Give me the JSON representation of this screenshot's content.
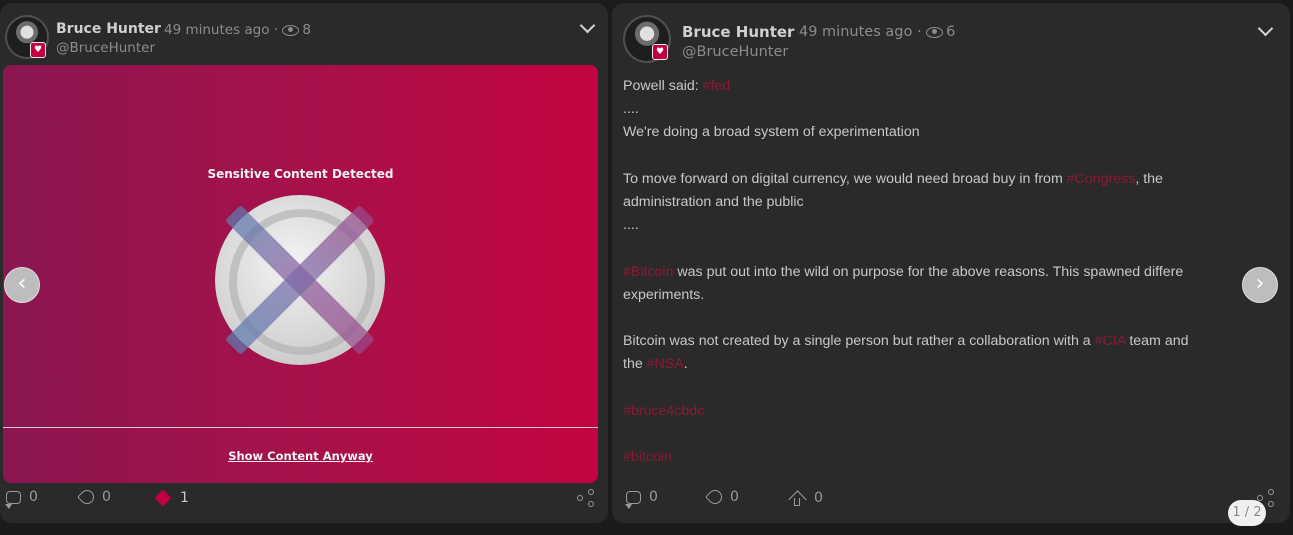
{
  "left_post": {
    "author": "Bruce Hunter",
    "time": "49 minutes ago",
    "separator": "·",
    "views": "8",
    "handle": "@BruceHunter",
    "media": {
      "sensitive_title": "Sensitive Content Detected",
      "show_anyway": "Show Content Anyway"
    },
    "actions": {
      "comments": "0",
      "boosts": "0",
      "reactions": "1"
    }
  },
  "right_post": {
    "author": "Bruce Hunter",
    "time": "49 minutes ago",
    "separator": "·",
    "views": "6",
    "handle": "@BruceHunter",
    "body": {
      "line1_prefix": "Powell said: ",
      "line1_tag": "#fed",
      "line2": "....",
      "line3": "We're doing a broad system of experimentation",
      "line4_prefix": "To move forward on digital currency, we would need broad buy in from ",
      "line4_tag": "#Congress",
      "line4_suffix": ", the",
      "line5": "administration and the public",
      "line6": "....",
      "line7_tag": "#Bitcoin",
      "line7_suffix": " was put out into the wild on purpose for the above reasons. This spawned differe",
      "line8": "experiments.",
      "line9_prefix": "Bitcoin was not created by a single person but rather a collaboration with a ",
      "line9_tag": "#CIA",
      "line9_suffix": " team and",
      "line10_prefix": "the ",
      "line10_tag": "#NSA",
      "line10_suffix": ".",
      "line11_tag": "#bruce4cbdc",
      "line12_tag": "#bitcoin"
    },
    "actions": {
      "comments": "0",
      "boosts": "0",
      "upvotes": "0"
    }
  },
  "pager": "1 / 2",
  "colors": {
    "accent": "#c2003f",
    "tag": "#8c1a34",
    "card_bg": "#2a2a2a"
  },
  "icons": [
    "eye-icon",
    "chevron-down-icon",
    "comment-icon",
    "rocket-icon",
    "fire-icon",
    "arrow-up-icon",
    "share-icon",
    "chevron-left-icon",
    "chevron-right-icon",
    "verified-badge-icon"
  ]
}
